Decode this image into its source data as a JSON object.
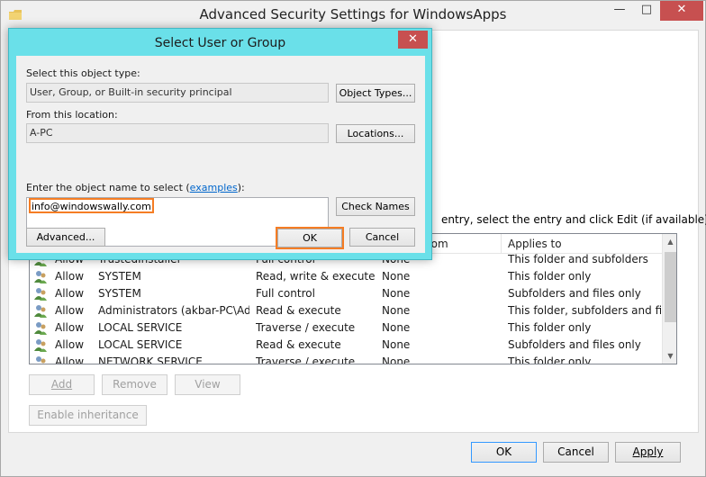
{
  "main_window": {
    "title": "Advanced Security Settings for WindowsApps",
    "controls": {
      "minimize": "—",
      "maximize": "□",
      "close": "✕"
    },
    "info_text": "entry, select the entry and click Edit (if available).",
    "table": {
      "headers": {
        "inherited_from": "rom",
        "applies_to": "Applies to"
      },
      "rows": [
        {
          "type": "Allow",
          "principal": "TrustedInstaller",
          "access": "Full control",
          "inherited": "None",
          "applies": "This folder and subfolders"
        },
        {
          "type": "Allow",
          "principal": "SYSTEM",
          "access": "Read, write & execute",
          "inherited": "None",
          "applies": "This folder only"
        },
        {
          "type": "Allow",
          "principal": "SYSTEM",
          "access": "Full control",
          "inherited": "None",
          "applies": "Subfolders and files only"
        },
        {
          "type": "Allow",
          "principal": "Administrators (akbar-PC\\Ad...",
          "access": "Read & execute",
          "inherited": "None",
          "applies": "This folder, subfolders and files"
        },
        {
          "type": "Allow",
          "principal": "LOCAL SERVICE",
          "access": "Traverse / execute",
          "inherited": "None",
          "applies": "This folder only"
        },
        {
          "type": "Allow",
          "principal": "LOCAL SERVICE",
          "access": "Read & execute",
          "inherited": "None",
          "applies": "Subfolders and files only"
        },
        {
          "type": "Allow",
          "principal": "NETWORK SERVICE",
          "access": "Traverse / execute",
          "inherited": "None",
          "applies": "This folder only"
        }
      ]
    },
    "buttons": {
      "add": "Add",
      "remove": "Remove",
      "view": "View",
      "enable_inheritance": "Enable inheritance",
      "ok": "OK",
      "cancel": "Cancel",
      "apply": "Apply"
    }
  },
  "dialog": {
    "title": "Select User or Group",
    "close": "✕",
    "object_type_label": "Select this object type:",
    "object_type_value": "User, Group, or Built-in security principal",
    "object_types_button": "Object Types...",
    "location_label": "From this location:",
    "location_value": "A-PC",
    "locations_button": "Locations...",
    "object_name_label_prefix": "Enter the object name to select (",
    "object_name_label_link": "examples",
    "object_name_label_suffix": "):",
    "object_name_value": "info@windowswally.com",
    "check_names_button": "Check Names",
    "advanced_button": "Advanced...",
    "ok_button": "OK",
    "cancel_button": "Cancel"
  },
  "colors": {
    "dialog_frame": "#6ae0e9",
    "close_button": "#c75050",
    "highlight_outline": "#f57d24",
    "link": "#0066cc"
  }
}
